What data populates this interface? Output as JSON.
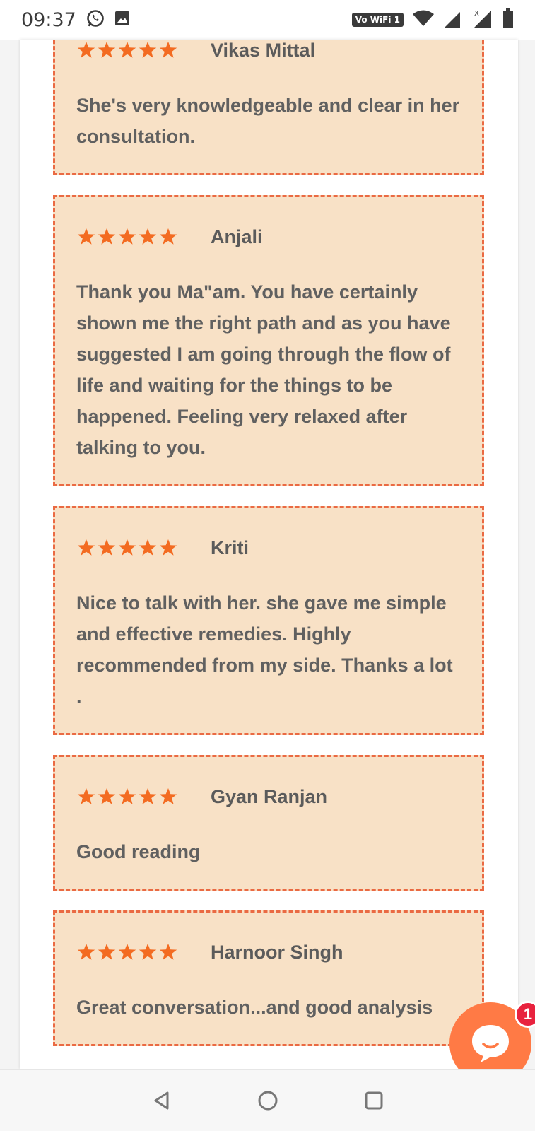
{
  "status_bar": {
    "time": "09:37",
    "left_icons": [
      "whatsapp-icon",
      "image-icon"
    ],
    "vowifi_label": "Vo WiFi 1",
    "right_icons": [
      "wifi-icon",
      "signal-icon",
      "signal-icon",
      "battery-icon"
    ]
  },
  "reviews": [
    {
      "name": "Vikas Mittal",
      "rating": 5,
      "text": "She's very knowledgeable and clear in her consultation."
    },
    {
      "name": "Anjali",
      "rating": 5,
      "text": "Thank you Ma\"am. You have certainly shown me the right path and as you have suggested I am going through the flow of life and waiting for the things to be happened. Feeling very relaxed after talking to you."
    },
    {
      "name": "Kriti",
      "rating": 5,
      "text": "Nice to talk with her. she gave me simple and effective remedies. Highly recommended from my side. Thanks a lot ."
    },
    {
      "name": "Gyan Ranjan",
      "rating": 5,
      "text": "Good reading"
    },
    {
      "name": "Harnoor Singh",
      "rating": 5,
      "text": "Great conversation...and good analysis"
    }
  ],
  "chat": {
    "badge_count": "1"
  },
  "colors": {
    "card_bg": "#f8e1c6",
    "card_border": "#ea6a43",
    "star": "#f36b21",
    "chat_fab": "#ff7a45",
    "badge": "#e8223e"
  },
  "nav_bar": {
    "buttons": [
      "back-icon",
      "home-icon",
      "recents-icon"
    ]
  }
}
